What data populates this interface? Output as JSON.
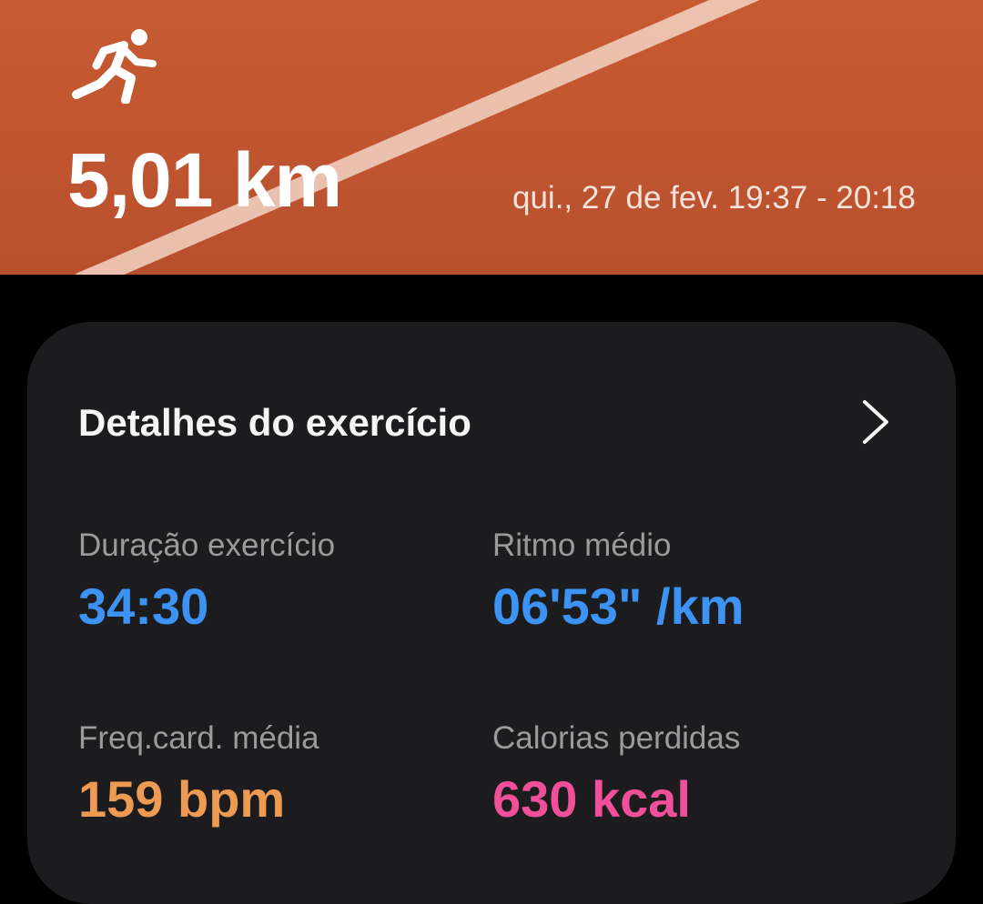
{
  "header": {
    "distance": "5,01 km",
    "datetime": "qui., 27 de fev. 19:37 - 20:18",
    "activity_icon": "running-person-icon",
    "background_color": "#c65a31"
  },
  "details": {
    "title": "Detalhes do exercício",
    "chevron_icon": "chevron-right-icon",
    "stats": [
      {
        "label": "Duração exercício",
        "value": "34:30",
        "color": "#3d93f3"
      },
      {
        "label": "Ritmo médio",
        "value": "06'53\" /km",
        "color": "#3d93f3"
      },
      {
        "label": "Freq.card. média",
        "value": "159 bpm",
        "color": "#ee9a52"
      },
      {
        "label": "Calorias perdidas",
        "value": "630 kcal",
        "color": "#f04f9a"
      }
    ]
  }
}
